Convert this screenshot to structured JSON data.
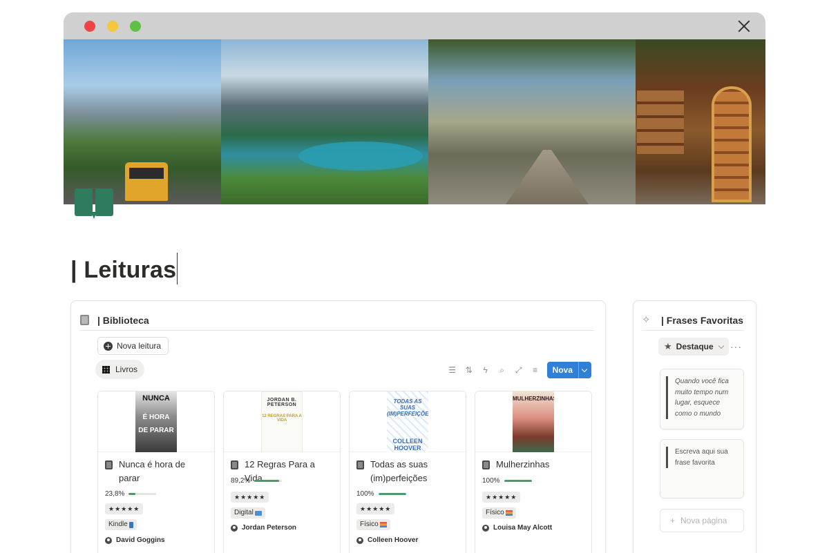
{
  "window": {
    "controls": [
      "close",
      "minimize",
      "zoom"
    ]
  },
  "page": {
    "title": "| Leituras"
  },
  "library": {
    "title": "| Biblioteca",
    "new_reading_label": "Nova leitura",
    "view_tab_label": "Livros",
    "new_button_label": "Nova",
    "books": [
      {
        "cover": {
          "line1": "NUNCA",
          "line2": "É HORA",
          "line3": "DE PARAR"
        },
        "title": "Nunca é hora de parar",
        "progress_text": "23,8%",
        "progress": 23.8,
        "rating": "★★★★★",
        "format": "Kindle",
        "author": "David Goggins"
      },
      {
        "cover": {
          "line1": "JORDAN B. PETERSON",
          "line2": "12 REGRAS PARA A VIDA"
        },
        "title": "12 Regras Para a Vida",
        "progress_text": "89,2%",
        "progress": 89.2,
        "rating": "★★★★★",
        "format": "Digital",
        "author": "Jordan Peterson"
      },
      {
        "cover": {
          "line1": "TODAS AS SUAS (IM)PERFEIÇÕES",
          "line2": "COLLEEN HOOVER"
        },
        "title": "Todas as suas (im)perfeições",
        "progress_text": "100%",
        "progress": 100,
        "rating": "★★★★★",
        "format": "Físico",
        "author": "Colleen Hoover"
      },
      {
        "cover": {
          "line1": "MULHERZINHAS"
        },
        "title": "Mulherzinhas",
        "progress_text": "100%",
        "progress": 100,
        "rating": "★★★★★",
        "format": "Físico",
        "author": "Louisa May Alcott"
      }
    ]
  },
  "favorites": {
    "title": "| Frases Favoritas",
    "filter_label": "Destaque",
    "quotes": [
      "Quando você fica muito tempo num lugar, esquece como o mundo",
      "Escreva aqui sua frase favorita"
    ],
    "new_page_label": "Nova página"
  },
  "colors": {
    "accent_blue": "#2f80d7",
    "progress_green": "#4a9a6a",
    "page_icon_green": "#2e7b5d"
  }
}
